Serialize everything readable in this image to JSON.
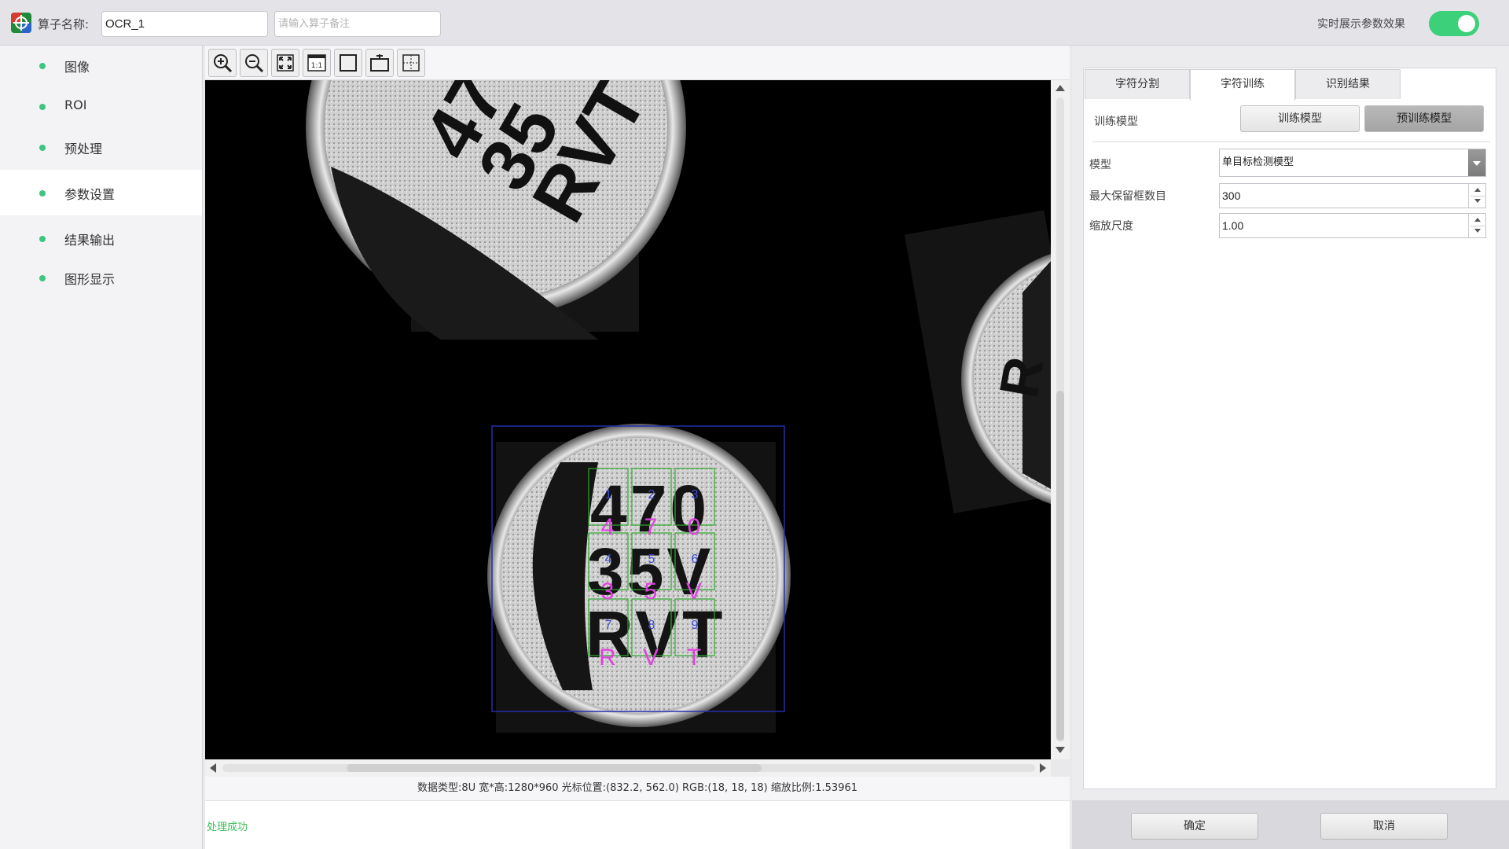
{
  "header": {
    "name_label": "算子名称:",
    "name_value": "OCR_1",
    "remark_placeholder": "请输入算子备注",
    "realtime_label": "实时展示参数效果",
    "realtime_on": true,
    "toggle_color": "#3dd07a"
  },
  "sidebar": {
    "items": [
      {
        "label": "图像"
      },
      {
        "label": "ROI"
      },
      {
        "label": "预处理"
      },
      {
        "label": "参数设置",
        "active": true
      },
      {
        "label": "结果输出"
      },
      {
        "label": "图形显示"
      }
    ]
  },
  "toolbar": {
    "tools": [
      "zoom-in-icon",
      "zoom-out-icon",
      "fit-screen-icon",
      "actual-size-icon",
      "rectangle-icon",
      "screenshot-icon",
      "crosshair-icon"
    ],
    "actual_size_text": "1:1"
  },
  "image": {
    "labels": [
      "4",
      "7",
      "0",
      "3",
      "5",
      "V",
      "R",
      "V",
      "T"
    ],
    "indices": [
      "1",
      "2",
      "3",
      "4",
      "5",
      "6",
      "7",
      "8",
      "9"
    ],
    "printed_text": [
      "470",
      "35V",
      "RVT"
    ],
    "top_chip_text": [
      "47",
      "35",
      "RVT"
    ],
    "right_chip_text": "R",
    "label_color": "#e040e0",
    "box_color": "#2faa2f",
    "roi_color": "#2230a8"
  },
  "status": {
    "info": "数据类型:8U 宽*高:1280*960 光标位置:(832.2, 562.0) RGB:(18, 18, 18) 缩放比例:1.53961",
    "log": "处理成功",
    "log_color": "#3cc05a"
  },
  "panel": {
    "tabs": [
      {
        "label": "字符分割"
      },
      {
        "label": "字符训练",
        "active": true
      },
      {
        "label": "识别结果"
      }
    ],
    "train_model_label": "训练模型",
    "train_button": "训练模型",
    "pretrained_button": "预训练模型",
    "params": {
      "model_label": "模型",
      "model_value": "单目标检测模型",
      "max_boxes_label": "最大保留框数目",
      "max_boxes_value": "300",
      "scale_label": "缩放尺度",
      "scale_value": "1.00"
    }
  },
  "footer": {
    "confirm": "确定",
    "cancel": "取消"
  }
}
